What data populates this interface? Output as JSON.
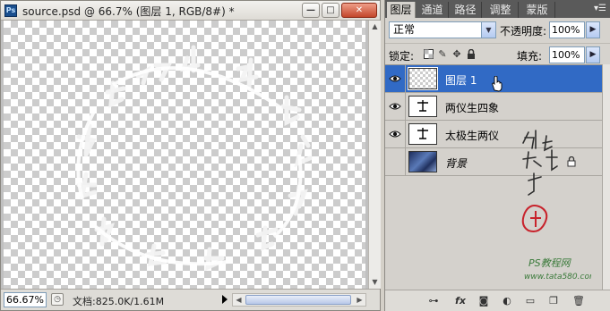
{
  "document": {
    "title": "source.psd @ 66.7% (图层 1, RGB/8#) *",
    "window_buttons": {
      "minimize": "—",
      "maximize": "□",
      "close": "✕"
    },
    "zoom": "66.67%",
    "info": "文档:825.0K/1.61M",
    "canvas_text_ring": [
      "极",
      "生",
      "两",
      "仪",
      "四",
      "象",
      "八",
      "卦",
      "吉",
      "凶",
      "大",
      "业",
      "太"
    ]
  },
  "panel": {
    "tabs": [
      {
        "label": "图层",
        "active": true
      },
      {
        "label": "通道",
        "active": false
      },
      {
        "label": "路径",
        "active": false
      },
      {
        "label": "调整",
        "active": false
      },
      {
        "label": "蒙版",
        "active": false
      }
    ],
    "menu_icon": "panel-menu-icon",
    "blend_mode": "正常",
    "opacity_label": "不透明度:",
    "opacity_value": "100%",
    "lock_label": "锁定:",
    "fill_label": "填充:",
    "fill_value": "100%",
    "layers": [
      {
        "name": "图层 1",
        "visible": true,
        "selected": true,
        "thumb": "transparent"
      },
      {
        "name": "两仪生四象",
        "visible": true,
        "selected": false,
        "thumb": "text"
      },
      {
        "name": "太极生两仪",
        "visible": true,
        "selected": false,
        "thumb": "text"
      },
      {
        "name": "背景",
        "visible": false,
        "selected": false,
        "thumb": "photo",
        "locked": true
      }
    ],
    "footer_icons": [
      "link-icon",
      "fx-icon",
      "mask-icon",
      "adjustment-icon",
      "folder-icon",
      "new-layer-icon",
      "trash-icon"
    ],
    "watermark": {
      "signature": "他他我帮你",
      "site_line1": "PS教程网",
      "site_line2": "www.tata580.com"
    }
  },
  "colors": {
    "selection": "#316ac5",
    "tabbar": "#5a5a5a",
    "watermark_red": "#c8232c",
    "watermark_green": "#3a7a3a"
  }
}
